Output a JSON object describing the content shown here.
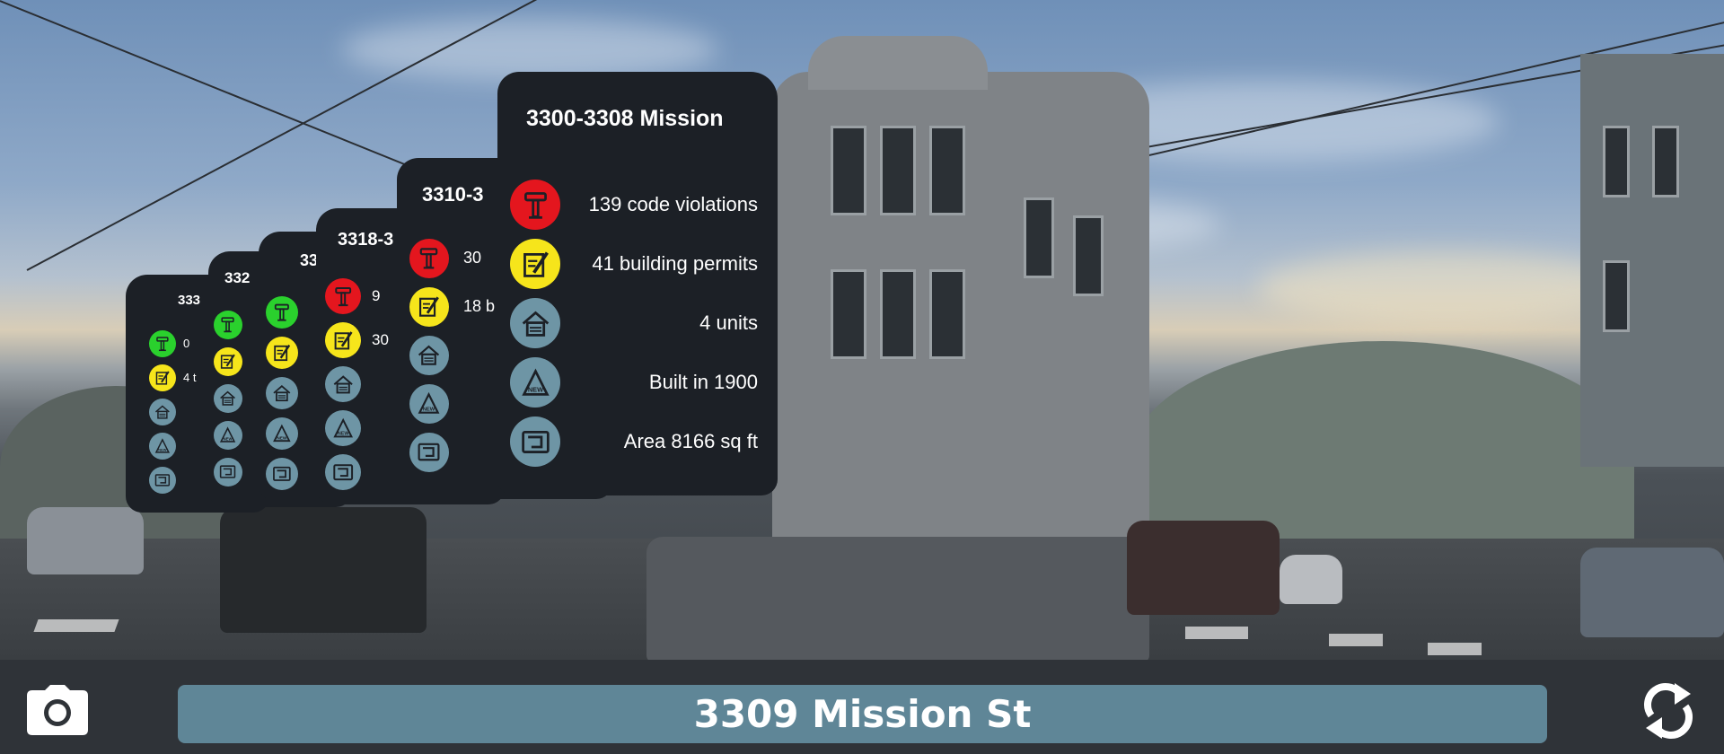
{
  "bottom_bar": {
    "address": "3309 Mission St",
    "camera_icon": "camera-icon",
    "refresh_icon": "refresh-icon"
  },
  "icon_names": {
    "violations": "gavel-icon",
    "permits": "permit-document-icon",
    "units": "house-icon",
    "built": "new-house-icon",
    "area": "floor-plan-icon"
  },
  "colors": {
    "card_bg": "#1c2026",
    "red": "#e4161e",
    "yellow": "#f6e51b",
    "green": "#2ad12d",
    "blue_icon": "#6e95a5",
    "address_bar": "#5f8697",
    "bottom_bar": "#2f3338"
  },
  "cards": [
    {
      "title": "3300-3308 Mission",
      "rows": [
        {
          "text": "139 code violations"
        },
        {
          "text": "41 building permits"
        },
        {
          "text": "4 units"
        },
        {
          "text": "Built in 1900"
        },
        {
          "text": "Area 8166 sq ft"
        }
      ]
    },
    {
      "title": "3310-3",
      "rows": [
        {
          "text": "30"
        },
        {
          "text": "18 b"
        },
        {
          "text": ""
        },
        {
          "text": ""
        },
        {
          "text": ""
        }
      ]
    },
    {
      "title": "3318-3",
      "rows": [
        {
          "text": "9"
        },
        {
          "text": "30"
        },
        {
          "text": ""
        },
        {
          "text": ""
        },
        {
          "text": ""
        }
      ]
    },
    {
      "title": "33",
      "rows": [
        {
          "text": ""
        },
        {
          "text": ""
        },
        {
          "text": ""
        },
        {
          "text": ""
        },
        {
          "text": ""
        }
      ]
    },
    {
      "title": "332",
      "rows": [
        {
          "text": ""
        },
        {
          "text": ""
        },
        {
          "text": ""
        },
        {
          "text": ""
        },
        {
          "text": ""
        }
      ]
    },
    {
      "title": "333",
      "rows": [
        {
          "text": "0"
        },
        {
          "text": "4 t"
        },
        {
          "text": ""
        },
        {
          "text": ""
        },
        {
          "text": ""
        }
      ]
    }
  ]
}
